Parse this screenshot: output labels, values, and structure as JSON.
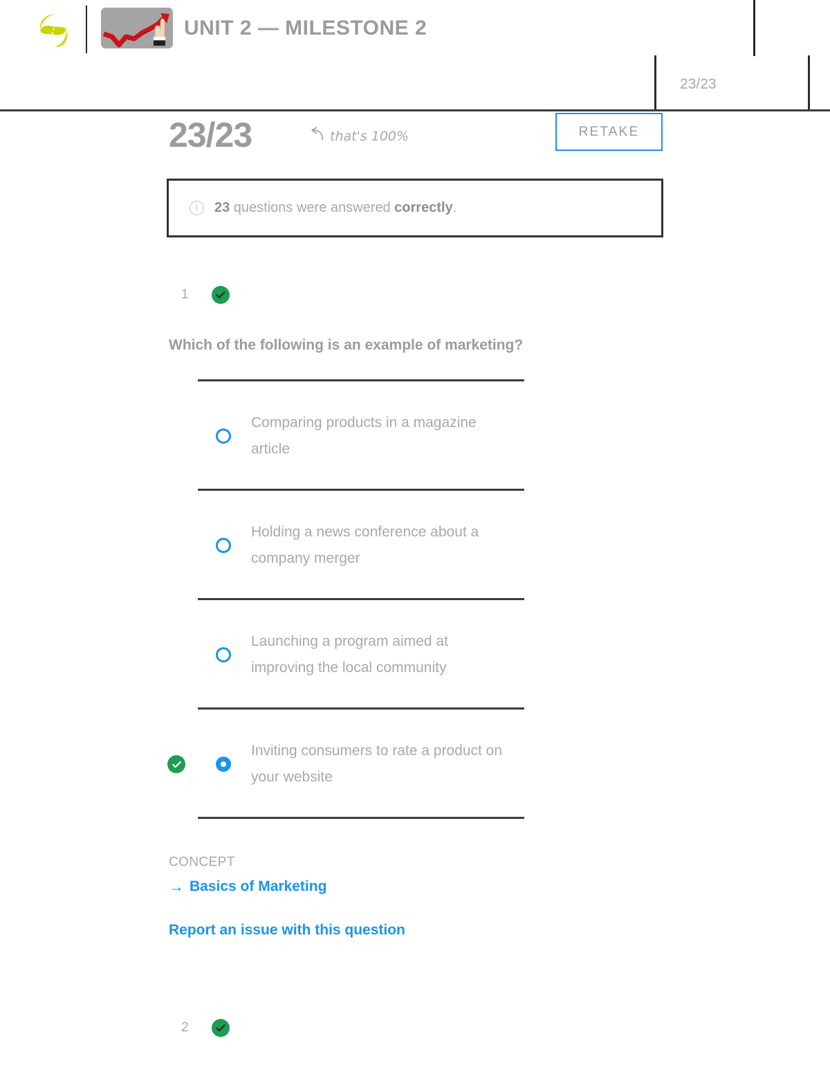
{
  "header": {
    "logo_icon": "sophia-logo-icon",
    "logo_color": "#c8d400",
    "thumbnail_icon": "growth-chart-thumbnail",
    "title": "UNIT 2 — MILESTONE 2",
    "score_badge": "23/23"
  },
  "score_row": {
    "score": "23/23",
    "arrow_icon": "curved-reply-arrow-icon",
    "note": "that's 100%",
    "retake_label": "RETAKE",
    "retake_border_color": "#1c94e8"
  },
  "info_banner": {
    "icon": "info-circle-icon",
    "count": "23",
    "text_before": " questions were answered ",
    "emphasis": "correctly",
    "text_after": "."
  },
  "questions": [
    {
      "number": "1",
      "status_icon": "check-circle-icon",
      "status_color": "#1f9d55",
      "prompt": "Which of the following is an example of marketing?",
      "options": [
        {
          "label": "Comparing products in a magazine article",
          "selected": false,
          "correct": false,
          "radio_icon": "radio-unchecked-icon"
        },
        {
          "label": "Holding a news conference about a company merger",
          "selected": false,
          "correct": false,
          "radio_icon": "radio-unchecked-icon"
        },
        {
          "label": "Launching a program aimed at improving the local community",
          "selected": false,
          "correct": false,
          "radio_icon": "radio-unchecked-icon"
        },
        {
          "label": "Inviting consumers to rate a product on your website",
          "selected": true,
          "correct": true,
          "radio_icon": "radio-checked-icon",
          "correct_icon": "check-circle-icon"
        }
      ],
      "concept_kicker": "CONCEPT",
      "concept_arrow": "→",
      "concept_link": "Basics of Marketing",
      "report_link": "Report an issue with this question"
    },
    {
      "number": "2",
      "status_icon": "check-circle-icon",
      "status_color": "#1f9d55"
    }
  ]
}
